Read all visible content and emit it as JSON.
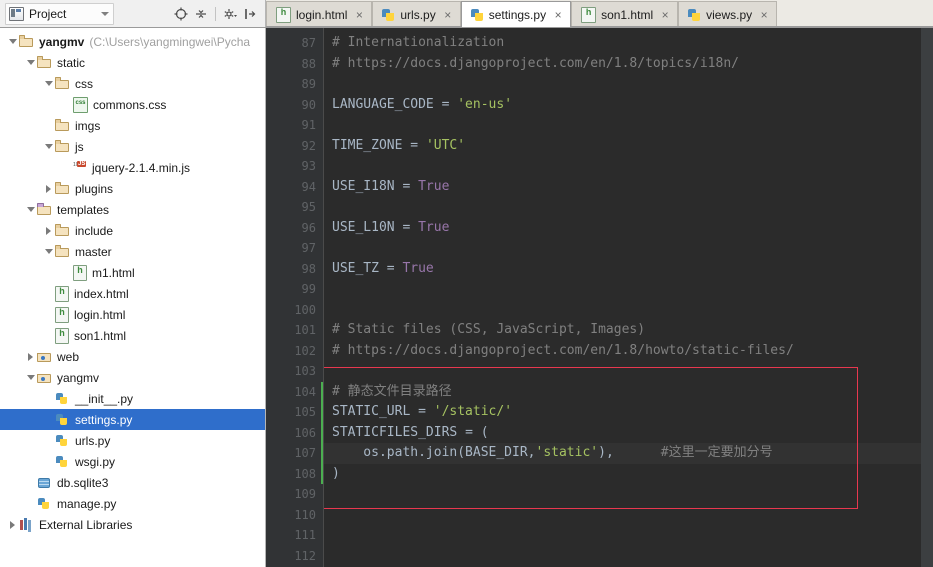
{
  "window": {
    "panel_title": "Project",
    "panel_icon": "project-icon",
    "dropdown_icon": "chevron-down-icon",
    "toolbar_icons": [
      "locate-target-icon",
      "collapse-all-icon",
      "settings-gear-icon",
      "hide-panel-icon"
    ]
  },
  "tabs": [
    {
      "label": "login.html",
      "type": "html",
      "active": false,
      "close": "×"
    },
    {
      "label": "urls.py",
      "type": "py",
      "active": false,
      "close": "×"
    },
    {
      "label": "settings.py",
      "type": "py",
      "active": true,
      "close": "×"
    },
    {
      "label": "son1.html",
      "type": "html",
      "active": false,
      "close": "×"
    },
    {
      "label": "views.py",
      "type": "py",
      "active": false,
      "close": "×"
    }
  ],
  "tree": [
    {
      "label": "yangmv",
      "path": "(C:\\Users\\yangmingwei\\Pycha",
      "indent": 0,
      "twisty": "open",
      "icon": "folder",
      "bold": true,
      "selected": false
    },
    {
      "label": "static",
      "indent": 1,
      "twisty": "open",
      "icon": "folder",
      "selected": false
    },
    {
      "label": "css",
      "indent": 2,
      "twisty": "open",
      "icon": "folder",
      "selected": false
    },
    {
      "label": "commons.css",
      "indent": 3,
      "twisty": "none",
      "icon": "css",
      "selected": false
    },
    {
      "label": "imgs",
      "indent": 2,
      "twisty": "none",
      "icon": "folder",
      "selected": false
    },
    {
      "label": "js",
      "indent": 2,
      "twisty": "open",
      "icon": "folder",
      "selected": false
    },
    {
      "label": "jquery-2.1.4.min.js",
      "indent": 3,
      "twisty": "none",
      "icon": "js",
      "selected": false
    },
    {
      "label": "plugins",
      "indent": 2,
      "twisty": "closed",
      "icon": "folder",
      "selected": false
    },
    {
      "label": "templates",
      "indent": 1,
      "twisty": "open",
      "icon": "folder-tpl",
      "selected": false
    },
    {
      "label": "include",
      "indent": 2,
      "twisty": "closed",
      "icon": "folder",
      "selected": false
    },
    {
      "label": "master",
      "indent": 2,
      "twisty": "open",
      "icon": "folder",
      "selected": false
    },
    {
      "label": "m1.html",
      "indent": 3,
      "twisty": "none",
      "icon": "htmlf",
      "selected": false
    },
    {
      "label": "index.html",
      "indent": 2,
      "twisty": "none",
      "icon": "htmlf",
      "selected": false
    },
    {
      "label": "login.html",
      "indent": 2,
      "twisty": "none",
      "icon": "htmlf",
      "selected": false
    },
    {
      "label": "son1.html",
      "indent": 2,
      "twisty": "none",
      "icon": "htmlf",
      "selected": false
    },
    {
      "label": "web",
      "indent": 1,
      "twisty": "closed",
      "icon": "folder-mod",
      "selected": false
    },
    {
      "label": "yangmv",
      "indent": 1,
      "twisty": "open",
      "icon": "folder-mod",
      "selected": false
    },
    {
      "label": "__init__.py",
      "indent": 2,
      "twisty": "none",
      "icon": "pyf",
      "selected": false
    },
    {
      "label": "settings.py",
      "indent": 2,
      "twisty": "none",
      "icon": "pyf",
      "selected": true
    },
    {
      "label": "urls.py",
      "indent": 2,
      "twisty": "none",
      "icon": "pyf",
      "selected": false
    },
    {
      "label": "wsgi.py",
      "indent": 2,
      "twisty": "none",
      "icon": "pyf",
      "selected": false
    },
    {
      "label": "db.sqlite3",
      "indent": 1,
      "twisty": "none",
      "icon": "db",
      "selected": false
    },
    {
      "label": "manage.py",
      "indent": 1,
      "twisty": "none",
      "icon": "pyf",
      "selected": false
    },
    {
      "label": "External Libraries",
      "indent": 0,
      "twisty": "closed",
      "icon": "lib",
      "selected": false
    }
  ],
  "editor": {
    "file": "settings.py",
    "first_line": 87,
    "last_line": 112,
    "current_line": 107,
    "lines": [
      {
        "n": 87,
        "tokens": [
          {
            "t": "# Internationalization",
            "c": "c-comment"
          }
        ]
      },
      {
        "n": 88,
        "tokens": [
          {
            "t": "# https://docs.djangoproject.com/en/1.8/topics/i18n/",
            "c": "c-comment"
          }
        ]
      },
      {
        "n": 89,
        "tokens": []
      },
      {
        "n": 90,
        "tokens": [
          {
            "t": "LANGUAGE_CODE ",
            "c": "c-ident"
          },
          {
            "t": "= ",
            "c": "c-op"
          },
          {
            "t": "'en-us'",
            "c": "c-str"
          }
        ]
      },
      {
        "n": 91,
        "tokens": []
      },
      {
        "n": 92,
        "tokens": [
          {
            "t": "TIME_ZONE ",
            "c": "c-ident"
          },
          {
            "t": "= ",
            "c": "c-op"
          },
          {
            "t": "'UTC'",
            "c": "c-str"
          }
        ]
      },
      {
        "n": 93,
        "tokens": []
      },
      {
        "n": 94,
        "tokens": [
          {
            "t": "USE_I18N ",
            "c": "c-ident"
          },
          {
            "t": "= ",
            "c": "c-op"
          },
          {
            "t": "True",
            "c": "c-const"
          }
        ]
      },
      {
        "n": 95,
        "tokens": []
      },
      {
        "n": 96,
        "tokens": [
          {
            "t": "USE_L10N ",
            "c": "c-ident"
          },
          {
            "t": "= ",
            "c": "c-op"
          },
          {
            "t": "True",
            "c": "c-const"
          }
        ]
      },
      {
        "n": 97,
        "tokens": []
      },
      {
        "n": 98,
        "tokens": [
          {
            "t": "USE_TZ ",
            "c": "c-ident"
          },
          {
            "t": "= ",
            "c": "c-op"
          },
          {
            "t": "True",
            "c": "c-const"
          }
        ]
      },
      {
        "n": 99,
        "tokens": []
      },
      {
        "n": 100,
        "tokens": []
      },
      {
        "n": 101,
        "tokens": [
          {
            "t": "# Static files (CSS, JavaScript, Images)",
            "c": "c-comment"
          }
        ]
      },
      {
        "n": 102,
        "tokens": [
          {
            "t": "# https://docs.djangoproject.com/en/1.8/howto/static-files/",
            "c": "c-comment"
          }
        ]
      },
      {
        "n": 103,
        "tokens": []
      },
      {
        "n": 104,
        "tokens": [
          {
            "t": "# ",
            "c": "c-comment"
          },
          {
            "t": "静态文件目录路径",
            "c": "c-cjk"
          }
        ]
      },
      {
        "n": 105,
        "tokens": [
          {
            "t": "STATIC_URL ",
            "c": "c-ident"
          },
          {
            "t": "= ",
            "c": "c-op"
          },
          {
            "t": "'/static/'",
            "c": "c-str"
          }
        ]
      },
      {
        "n": 106,
        "tokens": [
          {
            "t": "STATICFILES_DIRS ",
            "c": "c-ident"
          },
          {
            "t": "= (",
            "c": "c-op"
          }
        ]
      },
      {
        "n": 107,
        "tokens": [
          {
            "t": "    os.path.join(BASE_DIR,",
            "c": "c-ident"
          },
          {
            "t": "'static'",
            "c": "c-str"
          },
          {
            "t": "),",
            "c": "c-op"
          },
          {
            "t": "      #",
            "c": "c-comment"
          },
          {
            "t": "这里一定要加分号",
            "c": "c-cjk"
          }
        ]
      },
      {
        "n": 108,
        "tokens": [
          {
            "t": ")",
            "c": "c-op"
          }
        ]
      },
      {
        "n": 109,
        "tokens": []
      },
      {
        "n": 110,
        "tokens": []
      },
      {
        "n": 111,
        "tokens": []
      },
      {
        "n": 112,
        "tokens": []
      }
    ],
    "highlight_box": {
      "from_line": 103,
      "to_line": 109,
      "color": "#e8384f"
    },
    "vcs_change_lines": {
      "from_line": 104,
      "to_line": 108,
      "color": "#4caf50"
    }
  },
  "colors": {
    "editor_bg": "#2b2b2b",
    "gutter_bg": "#313335",
    "selection": "#2f6ecb",
    "accent_red": "#e8384f",
    "string": "#a5c261",
    "comment": "#808080",
    "constant": "#9876aa"
  }
}
